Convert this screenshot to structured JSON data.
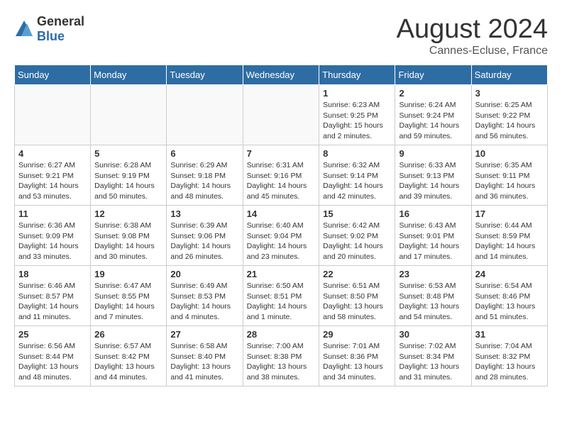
{
  "header": {
    "logo_general": "General",
    "logo_blue": "Blue",
    "month_title": "August 2024",
    "location": "Cannes-Ecluse, France"
  },
  "days_of_week": [
    "Sunday",
    "Monday",
    "Tuesday",
    "Wednesday",
    "Thursday",
    "Friday",
    "Saturday"
  ],
  "weeks": [
    [
      {
        "day": "",
        "info": ""
      },
      {
        "day": "",
        "info": ""
      },
      {
        "day": "",
        "info": ""
      },
      {
        "day": "",
        "info": ""
      },
      {
        "day": "1",
        "info": "Sunrise: 6:23 AM\nSunset: 9:25 PM\nDaylight: 15 hours\nand 2 minutes."
      },
      {
        "day": "2",
        "info": "Sunrise: 6:24 AM\nSunset: 9:24 PM\nDaylight: 14 hours\nand 59 minutes."
      },
      {
        "day": "3",
        "info": "Sunrise: 6:25 AM\nSunset: 9:22 PM\nDaylight: 14 hours\nand 56 minutes."
      }
    ],
    [
      {
        "day": "4",
        "info": "Sunrise: 6:27 AM\nSunset: 9:21 PM\nDaylight: 14 hours\nand 53 minutes."
      },
      {
        "day": "5",
        "info": "Sunrise: 6:28 AM\nSunset: 9:19 PM\nDaylight: 14 hours\nand 50 minutes."
      },
      {
        "day": "6",
        "info": "Sunrise: 6:29 AM\nSunset: 9:18 PM\nDaylight: 14 hours\nand 48 minutes."
      },
      {
        "day": "7",
        "info": "Sunrise: 6:31 AM\nSunset: 9:16 PM\nDaylight: 14 hours\nand 45 minutes."
      },
      {
        "day": "8",
        "info": "Sunrise: 6:32 AM\nSunset: 9:14 PM\nDaylight: 14 hours\nand 42 minutes."
      },
      {
        "day": "9",
        "info": "Sunrise: 6:33 AM\nSunset: 9:13 PM\nDaylight: 14 hours\nand 39 minutes."
      },
      {
        "day": "10",
        "info": "Sunrise: 6:35 AM\nSunset: 9:11 PM\nDaylight: 14 hours\nand 36 minutes."
      }
    ],
    [
      {
        "day": "11",
        "info": "Sunrise: 6:36 AM\nSunset: 9:09 PM\nDaylight: 14 hours\nand 33 minutes."
      },
      {
        "day": "12",
        "info": "Sunrise: 6:38 AM\nSunset: 9:08 PM\nDaylight: 14 hours\nand 30 minutes."
      },
      {
        "day": "13",
        "info": "Sunrise: 6:39 AM\nSunset: 9:06 PM\nDaylight: 14 hours\nand 26 minutes."
      },
      {
        "day": "14",
        "info": "Sunrise: 6:40 AM\nSunset: 9:04 PM\nDaylight: 14 hours\nand 23 minutes."
      },
      {
        "day": "15",
        "info": "Sunrise: 6:42 AM\nSunset: 9:02 PM\nDaylight: 14 hours\nand 20 minutes."
      },
      {
        "day": "16",
        "info": "Sunrise: 6:43 AM\nSunset: 9:01 PM\nDaylight: 14 hours\nand 17 minutes."
      },
      {
        "day": "17",
        "info": "Sunrise: 6:44 AM\nSunset: 8:59 PM\nDaylight: 14 hours\nand 14 minutes."
      }
    ],
    [
      {
        "day": "18",
        "info": "Sunrise: 6:46 AM\nSunset: 8:57 PM\nDaylight: 14 hours\nand 11 minutes."
      },
      {
        "day": "19",
        "info": "Sunrise: 6:47 AM\nSunset: 8:55 PM\nDaylight: 14 hours\nand 7 minutes."
      },
      {
        "day": "20",
        "info": "Sunrise: 6:49 AM\nSunset: 8:53 PM\nDaylight: 14 hours\nand 4 minutes."
      },
      {
        "day": "21",
        "info": "Sunrise: 6:50 AM\nSunset: 8:51 PM\nDaylight: 14 hours\nand 1 minute."
      },
      {
        "day": "22",
        "info": "Sunrise: 6:51 AM\nSunset: 8:50 PM\nDaylight: 13 hours\nand 58 minutes."
      },
      {
        "day": "23",
        "info": "Sunrise: 6:53 AM\nSunset: 8:48 PM\nDaylight: 13 hours\nand 54 minutes."
      },
      {
        "day": "24",
        "info": "Sunrise: 6:54 AM\nSunset: 8:46 PM\nDaylight: 13 hours\nand 51 minutes."
      }
    ],
    [
      {
        "day": "25",
        "info": "Sunrise: 6:56 AM\nSunset: 8:44 PM\nDaylight: 13 hours\nand 48 minutes."
      },
      {
        "day": "26",
        "info": "Sunrise: 6:57 AM\nSunset: 8:42 PM\nDaylight: 13 hours\nand 44 minutes."
      },
      {
        "day": "27",
        "info": "Sunrise: 6:58 AM\nSunset: 8:40 PM\nDaylight: 13 hours\nand 41 minutes."
      },
      {
        "day": "28",
        "info": "Sunrise: 7:00 AM\nSunset: 8:38 PM\nDaylight: 13 hours\nand 38 minutes."
      },
      {
        "day": "29",
        "info": "Sunrise: 7:01 AM\nSunset: 8:36 PM\nDaylight: 13 hours\nand 34 minutes."
      },
      {
        "day": "30",
        "info": "Sunrise: 7:02 AM\nSunset: 8:34 PM\nDaylight: 13 hours\nand 31 minutes."
      },
      {
        "day": "31",
        "info": "Sunrise: 7:04 AM\nSunset: 8:32 PM\nDaylight: 13 hours\nand 28 minutes."
      }
    ]
  ]
}
